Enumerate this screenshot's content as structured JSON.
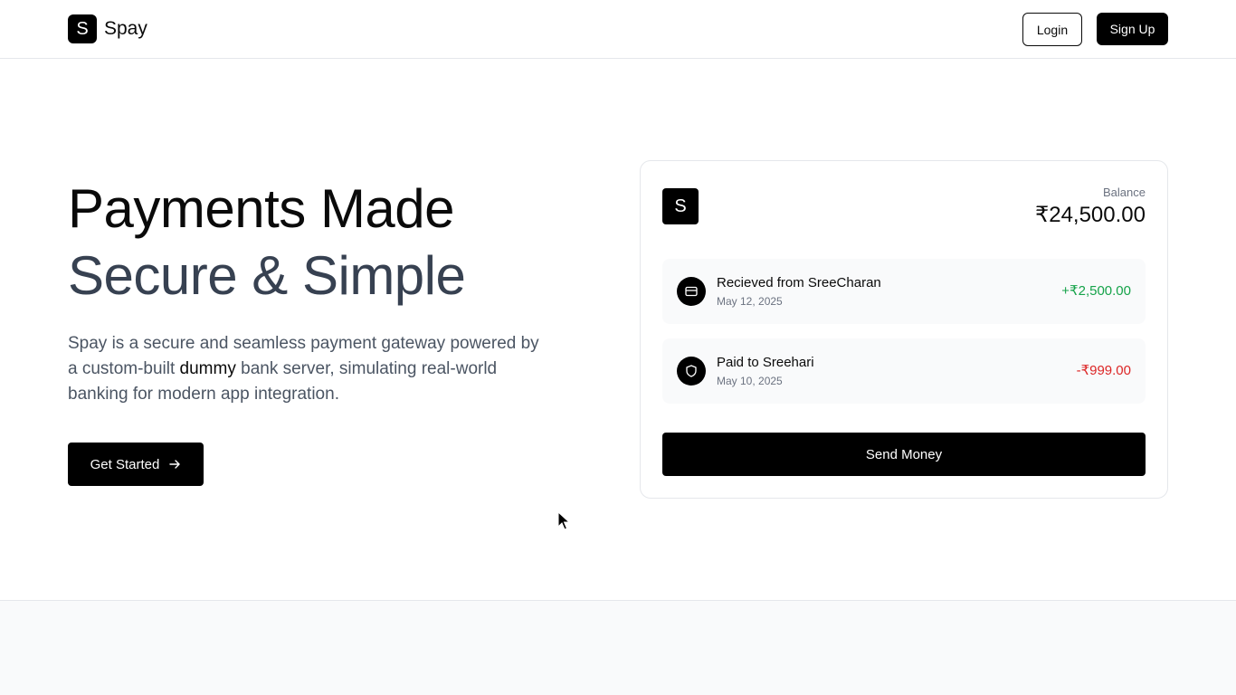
{
  "header": {
    "logo_letter": "S",
    "brand_name": "Spay",
    "login_label": "Login",
    "signup_label": "Sign Up"
  },
  "hero": {
    "title_line1": "Payments Made",
    "title_line2": "Secure & Simple",
    "description_part1": "Spay is a secure and seamless payment gateway powered by a custom-built ",
    "description_highlight": "dummy",
    "description_part2": " bank server, simulating real-world banking for modern app integration.",
    "cta_label": "Get Started"
  },
  "card": {
    "logo_letter": "S",
    "balance_label": "Balance",
    "balance_value": "₹24,500.00",
    "transactions": [
      {
        "title": "Recieved from SreeCharan",
        "date": "May 12, 2025",
        "amount": "+₹2,500.00",
        "icon": "credit-card-icon",
        "direction": "credit"
      },
      {
        "title": "Paid to Sreehari",
        "date": "May 10, 2025",
        "amount": "-₹999.00",
        "icon": "shield-icon",
        "direction": "debit"
      }
    ],
    "send_label": "Send Money"
  },
  "colors": {
    "accent": "#000000",
    "credit": "#16a34a",
    "debit": "#dc2626",
    "muted_text": "#4b5563"
  }
}
